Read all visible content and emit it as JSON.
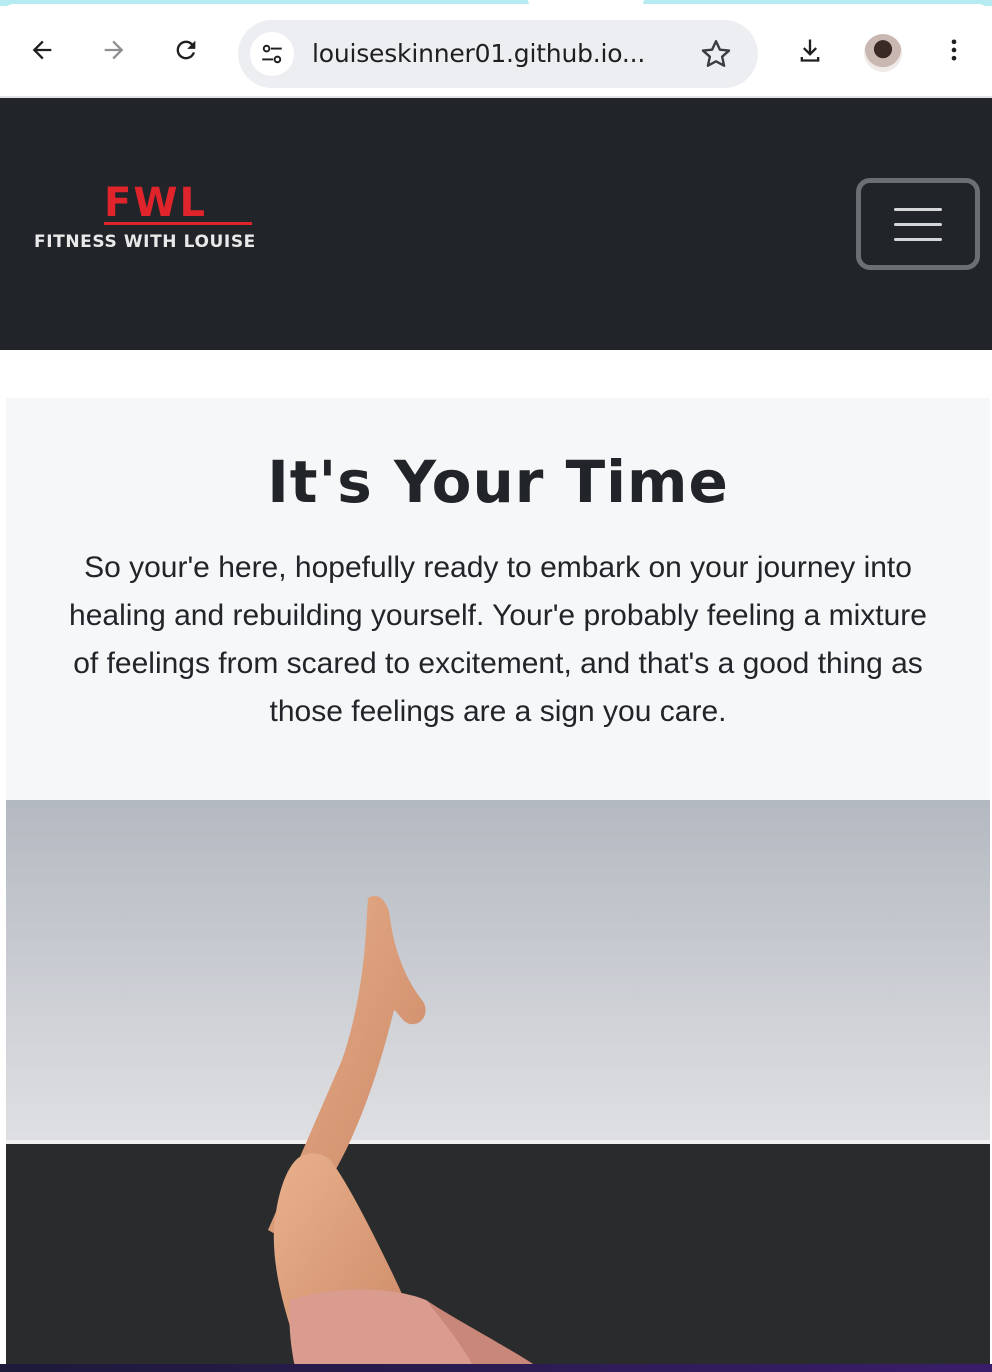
{
  "browser": {
    "url": "louiseskinner01.github.io...",
    "icons": {
      "back": "arrow-left-icon",
      "forward": "arrow-right-icon",
      "reload": "reload-icon",
      "site_info": "tune-icon",
      "bookmark": "star-icon",
      "download": "download-icon",
      "menu": "more-vert-icon"
    }
  },
  "navbar": {
    "logo_main": "FWL",
    "logo_sub": "FITNESS WITH LOUISE",
    "toggle_icon": "hamburger-icon",
    "background": "#212529",
    "brand_color": "#e0242b"
  },
  "hero": {
    "title": "It's Your Time",
    "text": "So your'e here, hopefully ready to embark on your journey into healing and rebuilding yourself. Your'e probably feeling a mixture of feelings from scared to excitement, and that's a good thing as those feelings are a sign you care."
  }
}
